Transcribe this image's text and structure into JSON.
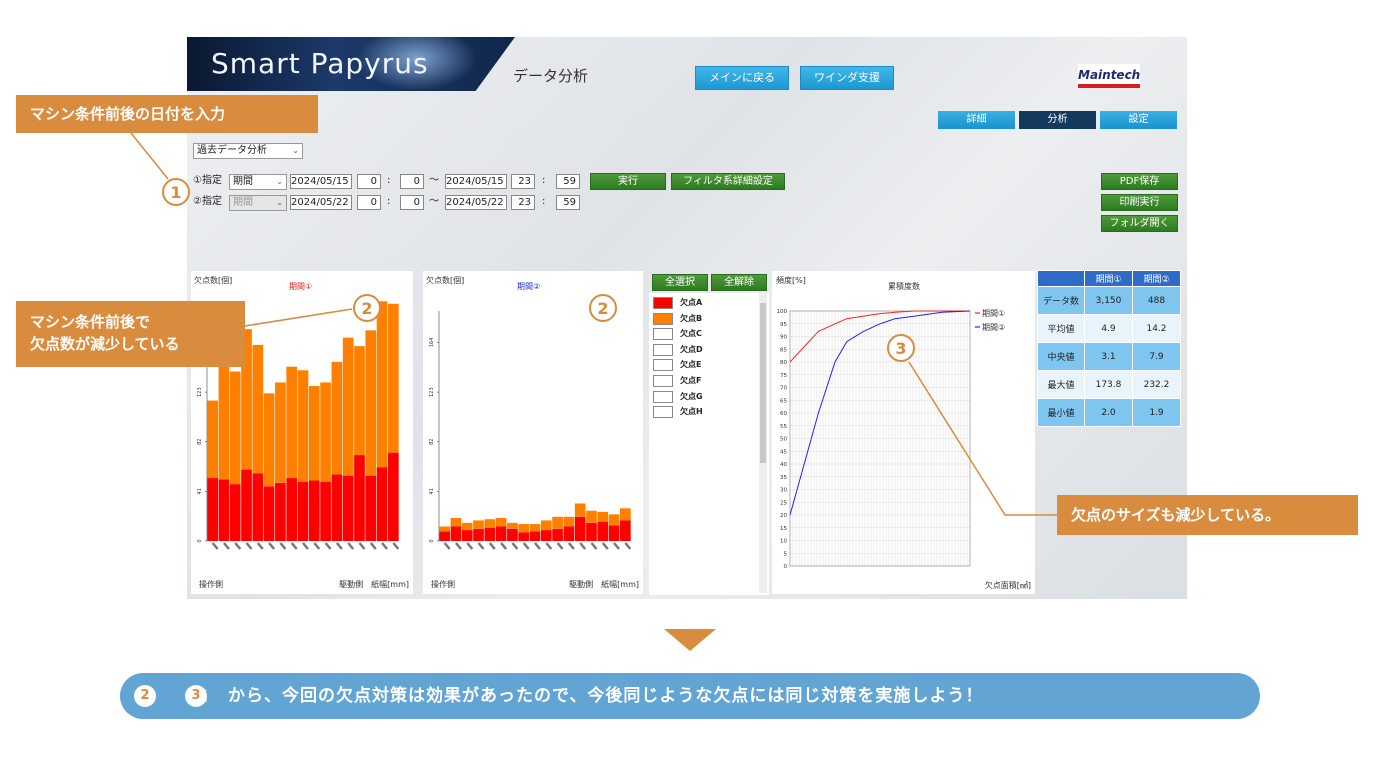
{
  "app": {
    "title": "Smart Papyrus",
    "screen_title": "データ分析",
    "buttons": {
      "main": "メインに戻る",
      "winder": "ワインダ支援"
    },
    "logo": "Maintech",
    "tabs": [
      {
        "label": "詳細"
      },
      {
        "label": "分析"
      },
      {
        "label": "設定"
      }
    ],
    "mode_select": "過去データ分析",
    "rows": [
      {
        "label": "①指定",
        "type": "期間",
        "start_date": "2024/05/15",
        "start_h": "0",
        "start_m": "0",
        "tilde": "～",
        "end_date": "2024/05/15",
        "end_h": "23",
        "end_m": "59"
      },
      {
        "label": "②指定",
        "type": "期間",
        "start_date": "2024/05/22",
        "start_h": "0",
        "start_m": "0",
        "tilde": "～",
        "end_date": "2024/05/22",
        "end_h": "23",
        "end_m": "59"
      }
    ],
    "colon": ":",
    "run_button": "実行",
    "filter_button": "フィルタ系詳細設定",
    "side_buttons": [
      "PDF保存",
      "印刷実行",
      "フォルダ開く"
    ]
  },
  "panel1": {
    "ylabel": "欠点数[個]",
    "title": "期間①",
    "left_label": "操作側",
    "right_label": "駆動側　紙幅[mm]",
    "yticks": [
      "0",
      "41",
      "82",
      "123",
      "164"
    ]
  },
  "panel2": {
    "ylabel": "欠点数[個]",
    "title": "期間②",
    "left_label": "操作側",
    "right_label": "駆動側　紙幅[mm]",
    "yticks": [
      "0",
      "41",
      "82",
      "123",
      "164"
    ]
  },
  "defects": {
    "select_all": "全選択",
    "clear_all": "全解除",
    "items": [
      {
        "label": "欠点A",
        "color": "#ff0000"
      },
      {
        "label": "欠点B",
        "color": "#ff8000"
      },
      {
        "label": "欠点C",
        "color": "#ffffff"
      },
      {
        "label": "欠点D",
        "color": "#ffffff"
      },
      {
        "label": "欠点E",
        "color": "#ffffff"
      },
      {
        "label": "欠点F",
        "color": "#ffffff"
      },
      {
        "label": "欠点G",
        "color": "#ffffff"
      },
      {
        "label": "欠点H",
        "color": "#ffffff"
      }
    ]
  },
  "cum_panel": {
    "ylabel": "頻度[%]",
    "title": "累積度数",
    "xlabel": "欠点面積[㎟]",
    "legend": [
      "期間①",
      "期間②"
    ]
  },
  "stats": {
    "headers": [
      "期間①",
      "期間②"
    ],
    "rows": [
      {
        "label": "データ数",
        "v1": "3,150",
        "v2": "488"
      },
      {
        "label": "平均値",
        "v1": "4.9",
        "v2": "14.2"
      },
      {
        "label": "中央値",
        "v1": "3.1",
        "v2": "7.9"
      },
      {
        "label": "最大値",
        "v1": "173.8",
        "v2": "232.2"
      },
      {
        "label": "最小値",
        "v1": "2.0",
        "v2": "1.9"
      }
    ]
  },
  "callouts": {
    "c1": "マシン条件前後の日付を入力",
    "c2_line1": "マシン条件前後で",
    "c2_line2": "欠点数が減少している",
    "c3": "欠点のサイズも減少している。",
    "n1": "1",
    "n2": "2",
    "n3": "3"
  },
  "bottom": {
    "text": "と　から、今回の欠点対策は効果があったので、今後同じような欠点には同じ対策を実施しよう！",
    "n2": "2",
    "n3": "3"
  },
  "chart_data": [
    {
      "type": "bar",
      "title": "期間①",
      "ylabel": "欠点数[個]",
      "ylim": [
        0,
        190
      ],
      "yticks": [
        0,
        41,
        82,
        123,
        164
      ],
      "series": [
        {
          "name": "欠点A",
          "color": "#ff0000",
          "values": [
            52,
            51,
            47,
            59,
            56,
            45,
            48,
            52,
            49,
            50,
            49,
            55,
            54,
            71,
            54,
            61,
            73
          ]
        },
        {
          "name": "欠点B",
          "color": "#ff8000",
          "values": [
            64,
            102,
            93,
            116,
            106,
            77,
            83,
            92,
            92,
            78,
            82,
            93,
            114,
            90,
            120,
            137,
            123
          ]
        }
      ]
    },
    {
      "type": "bar",
      "title": "期間②",
      "ylabel": "欠点数[個]",
      "ylim": [
        0,
        190
      ],
      "yticks": [
        0,
        41,
        82,
        123,
        164
      ],
      "series": [
        {
          "name": "欠点A",
          "color": "#ff0000",
          "values": [
            8,
            12,
            9,
            10,
            11,
            12,
            10,
            7,
            8,
            9,
            10,
            12,
            20,
            15,
            16,
            13,
            17
          ]
        },
        {
          "name": "欠点B",
          "color": "#ff8000",
          "values": [
            4,
            7,
            6,
            7,
            7,
            7,
            5,
            7,
            6,
            8,
            10,
            8,
            11,
            10,
            8,
            9,
            10
          ]
        }
      ]
    },
    {
      "type": "line",
      "title": "累積度数",
      "ylabel": "頻度[%]",
      "xlabel": "欠点面積[㎟]",
      "ylim": [
        0,
        100
      ],
      "yticks": [
        0,
        5,
        10,
        15,
        20,
        25,
        30,
        35,
        40,
        45,
        50,
        55,
        60,
        65,
        70,
        75,
        80,
        85,
        90,
        95,
        100
      ],
      "series": [
        {
          "name": "期間①",
          "color": "#ff2020",
          "x": [
            0,
            1,
            2,
            3,
            5,
            8,
            12,
            20,
            40,
            80
          ],
          "values": [
            80,
            92,
            95,
            97,
            98,
            99,
            99.5,
            100,
            100,
            100
          ]
        },
        {
          "name": "期間②",
          "color": "#2020ff",
          "x": [
            0,
            1,
            2,
            3,
            5,
            8,
            12,
            20,
            40,
            80
          ],
          "values": [
            20,
            60,
            80,
            88,
            92,
            95,
            97,
            98,
            99.5,
            100
          ]
        }
      ]
    }
  ]
}
